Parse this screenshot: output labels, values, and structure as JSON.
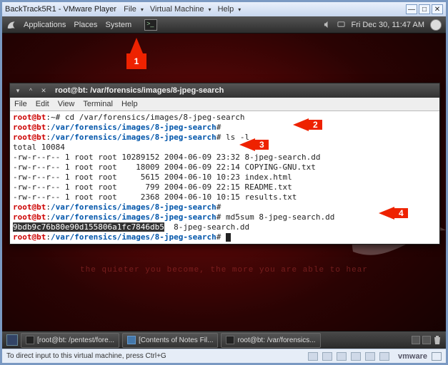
{
  "vm": {
    "title": "BackTrack5R1 - VMware Player",
    "menus": [
      "File",
      "Virtual Machine",
      "Help"
    ],
    "status_hint": "To direct input to this virtual machine, press Ctrl+G",
    "brand": "vmware"
  },
  "topbar": {
    "menus": [
      "Applications",
      "Places",
      "System"
    ],
    "clock": "Fri Dec 30, 11:47 AM"
  },
  "tagline": "the quieter you become, the more you are able to hear",
  "terminal": {
    "title": "root@bt: /var/forensics/images/8-jpeg-search",
    "menus": [
      "File",
      "Edit",
      "View",
      "Terminal",
      "Help"
    ],
    "prompt_user": "root@bt",
    "prompt_home": ":~#",
    "path": "/var/forensics/images/8-jpeg-search",
    "cmd1": " cd /var/forensics/images/8-jpeg-search",
    "cmd2": " ",
    "cmd3": " ls -l",
    "ls_total": "total 10084",
    "ls_rows": [
      "-rw-r--r-- 1 root root 10289152 2004-06-09 23:32 8-jpeg-search.dd",
      "-rw-r--r-- 1 root root    18009 2004-06-09 22:14 COPYING-GNU.txt",
      "-rw-r--r-- 1 root root     5615 2004-06-10 10:23 index.html",
      "-rw-r--r-- 1 root root      799 2004-06-09 22:15 README.txt",
      "-rw-r--r-- 1 root root     2368 2004-06-10 10:15 results.txt"
    ],
    "cmd4": " ",
    "cmd5": " md5sum 8-jpeg-search.dd",
    "md5": "9bdb9c76b80e90d155806a1fc7846db5",
    "md5_file": "  8-jpeg-search.dd",
    "cmd6": " "
  },
  "taskbar": {
    "items": [
      "[root@bt: /pentest/fore...",
      "[Contents of Notes Fil...",
      "root@bt: /var/forensics..."
    ]
  },
  "annotations": {
    "a1": "1",
    "a2": "2",
    "a3": "3",
    "a4": "4"
  }
}
